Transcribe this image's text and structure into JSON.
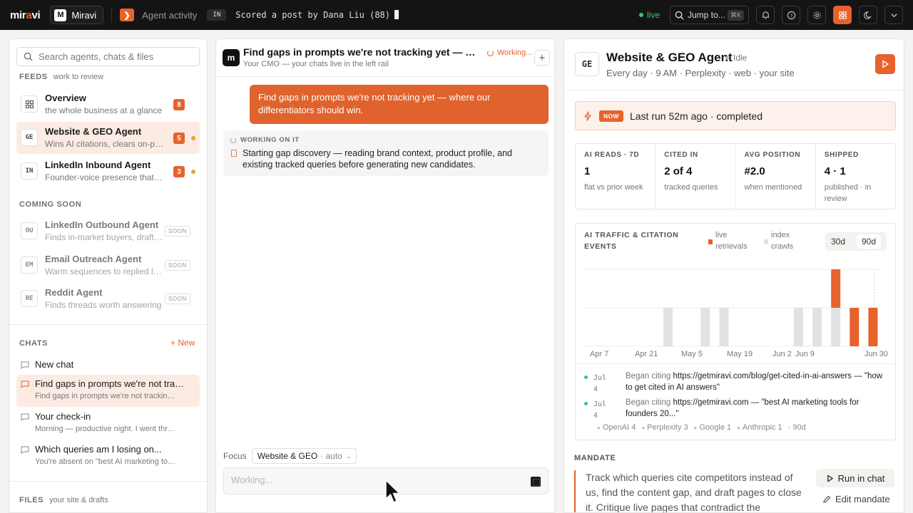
{
  "topbar": {
    "logo_prefix": "mir",
    "logo_dot": "a",
    "logo_suffix": "vi",
    "workspace_initial": "M",
    "workspace_name": "Miravi",
    "activity_label": "Agent activity",
    "activity_badge": "IN",
    "activity_message": "Scored a post by Dana Liu (88)",
    "status": "live",
    "jump_label": "Jump to...",
    "jump_shortcut": "⌘K"
  },
  "sidebar": {
    "search_placeholder": "Search agents, chats & files",
    "feeds_label": "FEEDS",
    "feeds_sub": "work to review",
    "feeds": [
      {
        "code": "▦",
        "name": "Overview",
        "desc": "the whole business at a glance",
        "count": "8"
      },
      {
        "code": "GE",
        "name": "Website & GEO Agent",
        "desc": "Wins AI citations, clears on-page issues",
        "count": "5"
      },
      {
        "code": "IN",
        "name": "LinkedIn Inbound Agent",
        "desc": "Founder-voice presence that compounds",
        "count": "3"
      }
    ],
    "coming_soon_label": "COMING SOON",
    "coming_soon": [
      {
        "code": "OU",
        "name": "LinkedIn Outbound Agent",
        "desc": "Finds in-market buyers, drafts outreach",
        "badge": "SOON"
      },
      {
        "code": "EM",
        "name": "Email Outreach Agent",
        "desc": "Warm sequences to replied leads",
        "badge": "SOON"
      },
      {
        "code": "RE",
        "name": "Reddit Agent",
        "desc": "Finds threads worth answering",
        "badge": "SOON"
      }
    ],
    "chats_label": "CHATS",
    "new_label": "+ New",
    "chats": [
      {
        "title": "New chat",
        "sub": ""
      },
      {
        "title": "Find gaps in prompts we're not tracking yet",
        "sub": "Find gaps in prompts we're not tracking yet"
      },
      {
        "title": "Your check-in",
        "sub": "Morning — productive night. I went through"
      },
      {
        "title": "Which queries am I losing on...",
        "sub": "You're absent on \"best AI marketing tools\""
      }
    ],
    "files_label": "FILES",
    "files_sub": "your site & drafts"
  },
  "chat": {
    "avatar": "m",
    "title": "Find gaps in prompts we're not tracking yet — where our differentiators should win.",
    "subtitle": "Your CMO — your chats live in the left rail",
    "status": "Working...",
    "user_message": "Find gaps in prompts we're not tracking yet — where our differentiators should win.",
    "working_label": "WORKING ON IT",
    "working_text": "Starting gap discovery — reading brand context, product profile, and existing tracked queries before generating new candidates.",
    "focus_label": "Focus",
    "focus_value": "Website & GEO",
    "focus_mode": "· auto",
    "composer_placeholder": "Working..."
  },
  "agent": {
    "code": "GE",
    "title": "Website & GEO Agent",
    "state": "Idle",
    "schedule": "Every day · 9 AM · Perplexity · web · your site",
    "now_badge": "NOW",
    "last_run": "Last run 52m ago · completed",
    "stats": [
      {
        "label": "AI READS · 7D",
        "value": "1",
        "note": "flat vs prior week"
      },
      {
        "label": "CITED IN",
        "value": "2 of 4",
        "note": "tracked queries"
      },
      {
        "label": "AVG POSITION",
        "value": "#2.0",
        "note": "when mentioned"
      },
      {
        "label": "SHIPPED",
        "value": "4 · 1",
        "note": "published · in review"
      }
    ],
    "events": [
      {
        "date": "Jul 4",
        "verb": "Began citing",
        "text": "https://getmiravi.com/blog/get-cited-in-ai-answers — \"how to get cited in AI answers\""
      },
      {
        "date": "Jul 4",
        "verb": "Began citing",
        "text": "https://getmiravi.com — \"best AI marketing tools for founders 20...\""
      }
    ],
    "providers": [
      "OpenAI 4",
      "Perplexity 3",
      "Google 1",
      "Anthropic 1"
    ],
    "providers_range": "· 90d",
    "mandate_label": "MANDATE",
    "mandate_text": "Track which queries cite competitors instead of us, find the content gap, and draft pages to close it. Critique live pages that contradict the",
    "run_in_chat": "Run in chat",
    "edit_mandate": "Edit mandate"
  },
  "chart_data": {
    "type": "bar",
    "title": "AI TRAFFIC & CITATION EVENTS",
    "legend": [
      "live retrievals",
      "index crawls"
    ],
    "range_tabs": [
      "30d",
      "90d"
    ],
    "active_range": "90d",
    "x_labels": [
      "Apr 7",
      "Apr 21",
      "May 5",
      "May 19",
      "Jun 2",
      "Jun 9",
      "Jun 30"
    ],
    "series": [
      {
        "name": "index crawls",
        "values": [
          0,
          0,
          0,
          0,
          1,
          0,
          1,
          1,
          0,
          0,
          0,
          1,
          1,
          1,
          0,
          0
        ]
      },
      {
        "name": "live retrievals",
        "values": [
          0,
          0,
          0,
          0,
          0,
          0,
          0,
          0,
          0,
          0,
          0,
          0,
          0,
          1,
          1,
          1
        ]
      }
    ],
    "ylim": [
      0,
      2
    ],
    "colors": {
      "live": "#e8622c",
      "crawl": "#e2e2e2"
    }
  }
}
